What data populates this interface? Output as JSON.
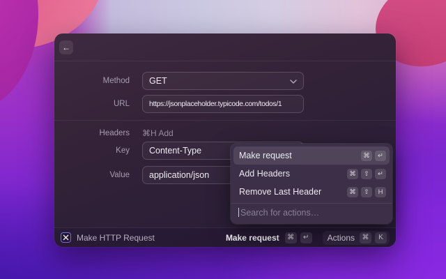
{
  "window": {
    "back_icon": "←",
    "form": {
      "method": {
        "label": "Method",
        "value": "GET"
      },
      "url": {
        "label": "URL",
        "value": "https://jsonplaceholder.typicode.com/todos/1"
      },
      "headers": {
        "label": "Headers",
        "shortcut_hint": "⌘H Add"
      },
      "key": {
        "label": "Key",
        "value": "Content-Type"
      },
      "value": {
        "label": "Value",
        "value": "application/json"
      }
    },
    "actions_popup": {
      "items": [
        {
          "label": "Make request",
          "keys": [
            "⌘",
            "↵"
          ]
        },
        {
          "label": "Add Headers",
          "keys": [
            "⌘",
            "⇧",
            "↵"
          ]
        },
        {
          "label": "Remove Last Header",
          "keys": [
            "⌘",
            "⇧",
            "H"
          ]
        }
      ],
      "search_placeholder": "Search for actions…"
    },
    "footer": {
      "app_title": "Make HTTP Request",
      "primary_action": {
        "label": "Make request",
        "keys": [
          "⌘",
          "↵"
        ]
      },
      "actions_button": {
        "label": "Actions",
        "keys": [
          "⌘",
          "K"
        ]
      }
    }
  },
  "colors": {
    "panel_top": "#3e2941",
    "panel_bottom": "#271c36",
    "popup_bg": "#3d2f48",
    "wallpaper_magenta": "#bd2fa9",
    "wallpaper_violet": "#8d2ae4",
    "wallpaper_deep_blue": "#3a15a2",
    "wallpaper_pink": "#e25f8d",
    "icon_border_blue": "#4f7cf7",
    "icon_border_purple": "#a34fe0"
  }
}
